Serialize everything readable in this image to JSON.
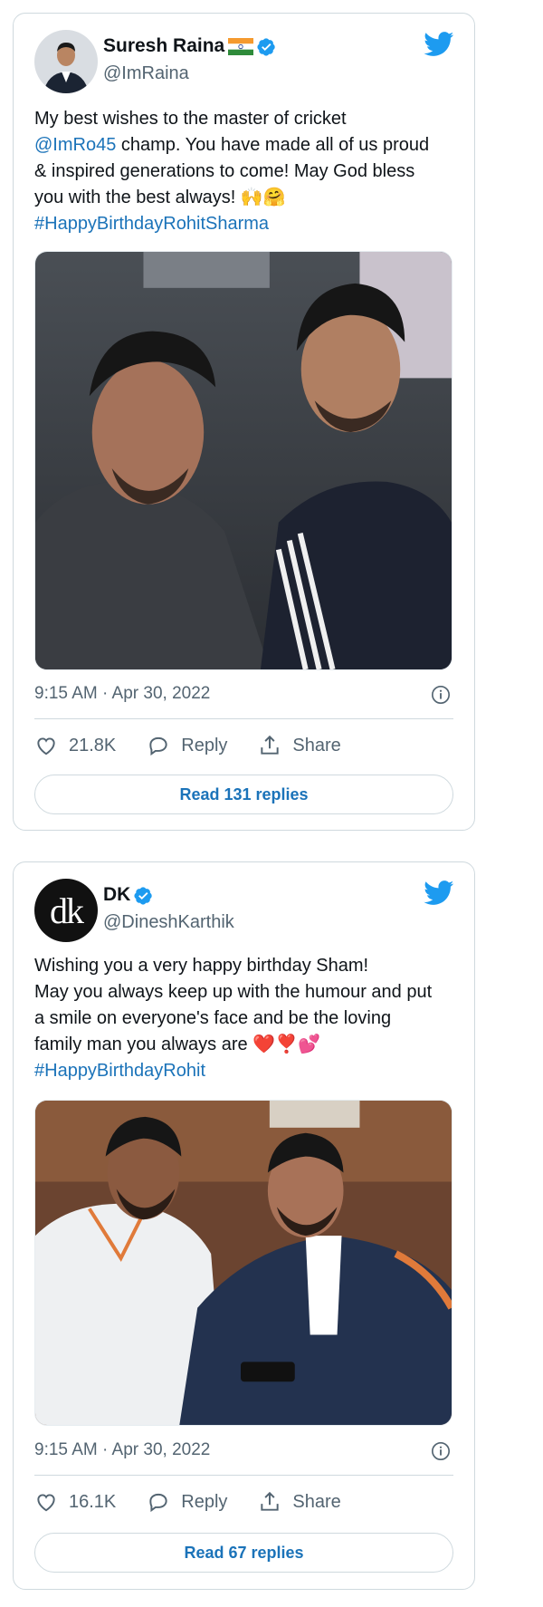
{
  "tweets": [
    {
      "author_name": "Suresh Raina",
      "author_flag_icon": "india-flag-icon",
      "handle": "@ImRaina",
      "text_line1": "My best wishes to the master of cricket",
      "mention": "@ImRo45",
      "text_line2": " champ. You have made all of us proud",
      "text_line3": "& inspired generations to come! May God bless",
      "text_line4": "you with the best always! ",
      "emojis": "🙌🤗",
      "hashtag": "#HappyBirthdayRohitSharma",
      "timestamp": "9:15 AM · Apr 30, 2022",
      "likes": "21.8K",
      "reply_label": "Reply",
      "share_label": "Share",
      "read_replies": "Read 131 replies"
    },
    {
      "author_name": "DK",
      "avatar_text": "dk",
      "handle": "@DineshKarthik",
      "text_line1": "Wishing you a very happy birthday Sham!",
      "text_line2": "May you always keep up with the humour and put",
      "text_line3": "a smile on everyone's face and be the loving",
      "text_line4": "family man you always are ",
      "emojis": "❤️❣️💕",
      "hashtag": "#HappyBirthdayRohit",
      "timestamp": "9:15 AM · Apr 30, 2022",
      "likes": "16.1K",
      "reply_label": "Reply",
      "share_label": "Share",
      "read_replies": "Read 67 replies"
    }
  ],
  "colors": {
    "link": "#1b73b9",
    "twitter_blue": "#1d9bf0",
    "muted": "#536471",
    "border": "#cfd9de"
  }
}
